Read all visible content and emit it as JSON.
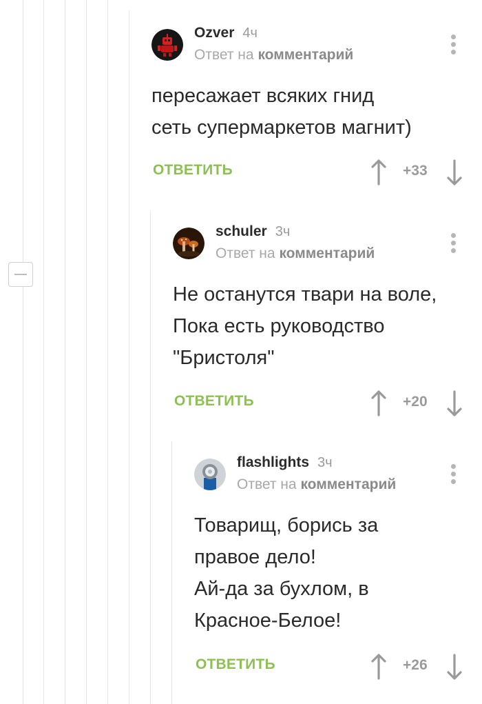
{
  "comments": [
    {
      "author": "Ozver",
      "age": "4ч",
      "reply_prefix": "Ответ на",
      "reply_target": "комментарий",
      "text": [
        "пересажает всяких гнид",
        "сеть супермаркетов магнит)"
      ],
      "reply_label": "ОТВЕТИТЬ",
      "score": "+33",
      "avatar_icon": "red-robot-avatar"
    },
    {
      "author": "schuler",
      "age": "3ч",
      "reply_prefix": "Ответ на",
      "reply_target": "комментарий",
      "text": [
        "Не останутся твари на воле,",
        "Пока есть руководство",
        "\"Бристоля\""
      ],
      "reply_label": "ОТВЕТИТЬ",
      "score": "+20",
      "avatar_icon": "mushrooms-avatar"
    },
    {
      "author": "flashlights",
      "age": "3ч",
      "reply_prefix": "Ответ на",
      "reply_target": "комментарий",
      "text": [
        "Товарищ, борись за",
        "правое дело!",
        "Ай-да за бухлом, в",
        "Красное-Белое!"
      ],
      "reply_label": "ОТВЕТИТЬ",
      "score": "+26",
      "avatar_icon": "flashlight-avatar"
    }
  ],
  "colors": {
    "accent_green": "#8cc152",
    "muted_gray": "#9a9a9a",
    "thread_line": "#e6e6e6"
  }
}
